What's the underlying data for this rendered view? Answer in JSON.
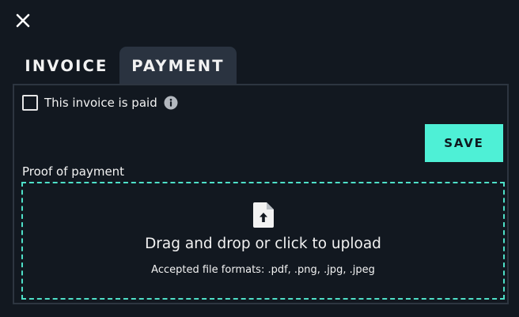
{
  "dialog": {
    "tabs": [
      {
        "label": "INVOICE",
        "active": false
      },
      {
        "label": "PAYMENT",
        "active": true
      }
    ]
  },
  "payment": {
    "paid_checkbox": {
      "label": "This invoice is paid",
      "checked": false
    },
    "info_icon": "info-circle",
    "save_label": "SAVE",
    "proof_label": "Proof of payment",
    "upload": {
      "icon": "file-upload",
      "title": "Drag and drop or click to upload",
      "formats": "Accepted file formats: .pdf, .png, .jpg, .jpeg"
    }
  },
  "colors": {
    "background": "#121820",
    "active_tab": "#2a3340",
    "accent": "#4ef0d6",
    "dashed_border": "#4ee0c8",
    "panel_border": "#2d3540"
  }
}
